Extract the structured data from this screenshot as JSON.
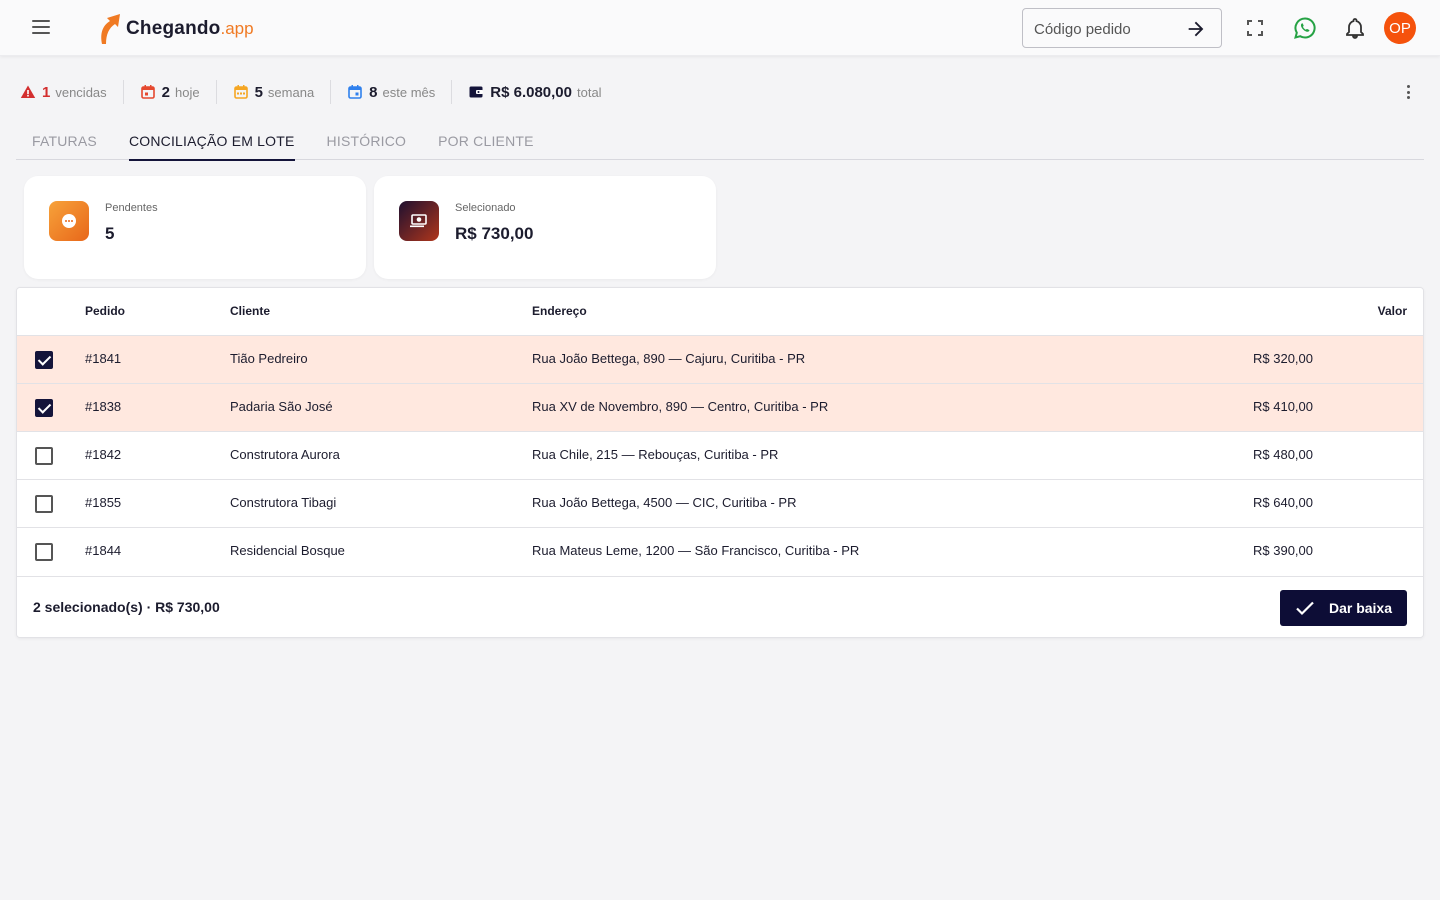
{
  "header": {
    "logo_text": "Chegando",
    "logo_suffix": ".app",
    "search": {
      "placeholder": "Código pedido",
      "value": ""
    },
    "avatar_initials": "OP"
  },
  "stats": [
    {
      "icon": "warning-icon",
      "number": "1",
      "label": "vencidas",
      "color": "#d32f2f"
    },
    {
      "icon": "calendar-today-icon",
      "number": "2",
      "label": "hoje",
      "color": "#e5482f"
    },
    {
      "icon": "calendar-week-icon",
      "number": "5",
      "label": "semana",
      "color": "#f5a623"
    },
    {
      "icon": "calendar-month-icon",
      "number": "8",
      "label": "este mês",
      "color": "#2f80ed"
    },
    {
      "icon": "wallet-icon",
      "number": "R$ 6.080,00",
      "label": "total",
      "color": "#14143a"
    }
  ],
  "tabs": [
    {
      "label": "FATURAS",
      "active": false
    },
    {
      "label": "CONCILIAÇÃO EM LOTE",
      "active": true
    },
    {
      "label": "HISTÓRICO",
      "active": false
    },
    {
      "label": "POR CLIENTE",
      "active": false
    }
  ],
  "cards": [
    {
      "label": "Pendentes",
      "value": "5",
      "icon": "pending-icon",
      "gradient": [
        "#f7a23a",
        "#e8671a"
      ]
    },
    {
      "label": "Selecionado",
      "value": "R$ 730,00",
      "icon": "cash-icon",
      "gradient": [
        "#1f1030",
        "#b0361c"
      ]
    }
  ],
  "table": {
    "columns": [
      "Pedido",
      "Cliente",
      "Endereço",
      "Valor"
    ],
    "rows": [
      {
        "pedido": "#1841",
        "cliente": "Tião Pedreiro",
        "endereco": "Rua João Bettega, 890 — Cajuru, Curitiba - PR",
        "valor": "R$ 320,00",
        "selected": true
      },
      {
        "pedido": "#1838",
        "cliente": "Padaria São José",
        "endereco": "Rua XV de Novembro, 890 — Centro, Curitiba - PR",
        "valor": "R$ 410,00",
        "selected": true
      },
      {
        "pedido": "#1842",
        "cliente": "Construtora Aurora",
        "endereco": "Rua Chile, 215 — Rebouças, Curitiba - PR",
        "valor": "R$ 480,00",
        "selected": false
      },
      {
        "pedido": "#1855",
        "cliente": "Construtora Tibagi",
        "endereco": "Rua João Bettega, 4500 — CIC, Curitiba - PR",
        "valor": "R$ 640,00",
        "selected": false
      },
      {
        "pedido": "#1844",
        "cliente": "Residencial Bosque",
        "endereco": "Rua Mateus Leme, 1200 — São Francisco, Curitiba - PR",
        "valor": "R$ 390,00",
        "selected": false
      }
    ]
  },
  "footer": {
    "summary": "2 selecionado(s) · R$ 730,00",
    "action_label": "Dar baixa"
  },
  "colors": {
    "primary": "#0d0d36",
    "accent": "#f07a23",
    "selected_row": "#ffe8df",
    "whatsapp": "#25a244"
  }
}
